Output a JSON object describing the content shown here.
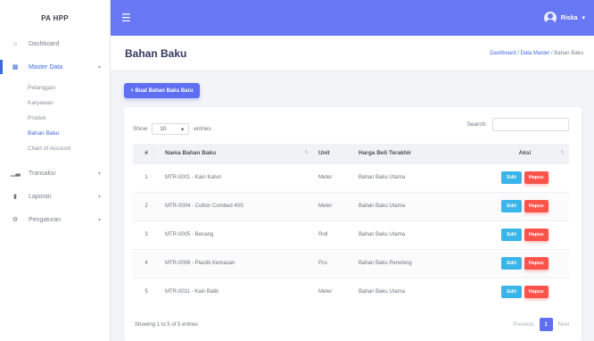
{
  "brand": "PA HPP",
  "topbar": {
    "menu_icon": "hamburger-icon",
    "user_name": "Riska",
    "caret": "▾"
  },
  "sidebar": {
    "items": [
      {
        "label": "Dashboard",
        "icon": "home-icon"
      },
      {
        "label": "Master Data",
        "icon": "database-icon",
        "active": true
      },
      {
        "label": "Transaksi",
        "icon": "chart-icon"
      },
      {
        "label": "Laporan",
        "icon": "file-icon"
      },
      {
        "label": "Pengaturan",
        "icon": "gears-icon"
      }
    ],
    "submenu": [
      "Pelanggan",
      "Karyawan",
      "Produk",
      "Bahan Baku",
      "Chart of Account"
    ]
  },
  "page": {
    "title": "Bahan Baku",
    "breadcrumb": [
      "Dashboard",
      "Data Master",
      "Bahan Baku"
    ],
    "breadcrumb_sep": "/"
  },
  "add_button": "+ Buat Bahan Baku Baru",
  "table_controls": {
    "show_label": "Show",
    "length_value": "10",
    "entries_label": "entries",
    "search_label": "Search:"
  },
  "table": {
    "headers": [
      "#",
      "Nama Bahan Baku",
      "Unit",
      "Harga Beli Terakhir",
      "Aksi"
    ],
    "rows": [
      {
        "no": "1",
        "name": "MTR-0001 - Kain Katun",
        "unit": "Meter",
        "harga": "Bahan Baku Utama"
      },
      {
        "no": "2",
        "name": "MTR-0004 - Cotton Combed 40S",
        "unit": "Meter",
        "harga": "Bahan Baku Utama"
      },
      {
        "no": "3",
        "name": "MTR-0005 - Benang",
        "unit": "Roll",
        "harga": "Bahan Baku Utama"
      },
      {
        "no": "4",
        "name": "MTR-0008 - Plastik Kemasan",
        "unit": "Pcs",
        "harga": "Bahan Baku Penolong"
      },
      {
        "no": "5",
        "name": "MTR-0011 - Kain Batik",
        "unit": "Meter",
        "harga": "Bahan Baku Utama"
      }
    ],
    "edit_label": "Edit",
    "delete_label": "Hapus"
  },
  "footer": {
    "info": "Showing 1 to 5 of 5 entries",
    "previous": "Previous",
    "current_page": "1",
    "next": "Next"
  }
}
